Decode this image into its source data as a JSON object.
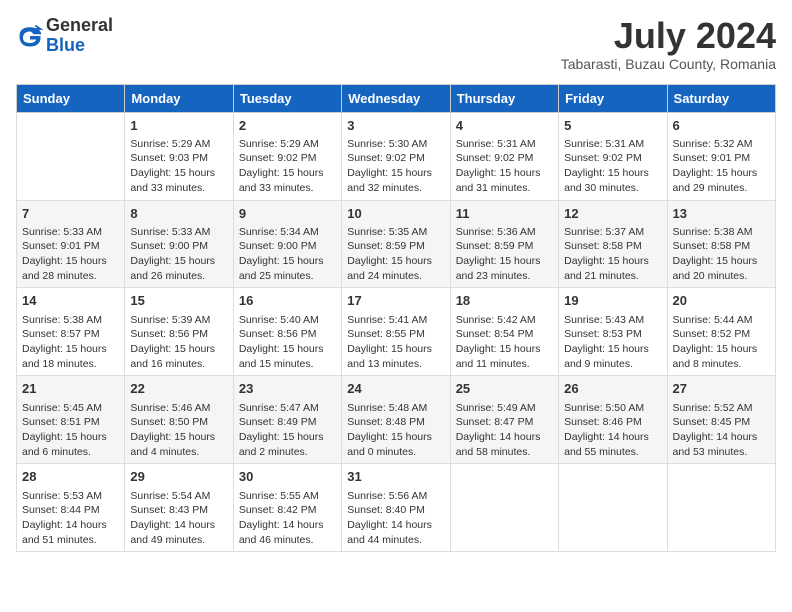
{
  "header": {
    "logo_general": "General",
    "logo_blue": "Blue",
    "month_title": "July 2024",
    "subtitle": "Tabarasti, Buzau County, Romania"
  },
  "days_of_week": [
    "Sunday",
    "Monday",
    "Tuesday",
    "Wednesday",
    "Thursday",
    "Friday",
    "Saturday"
  ],
  "weeks": [
    [
      {
        "day": "",
        "info": ""
      },
      {
        "day": "1",
        "info": "Sunrise: 5:29 AM\nSunset: 9:03 PM\nDaylight: 15 hours\nand 33 minutes."
      },
      {
        "day": "2",
        "info": "Sunrise: 5:29 AM\nSunset: 9:02 PM\nDaylight: 15 hours\nand 33 minutes."
      },
      {
        "day": "3",
        "info": "Sunrise: 5:30 AM\nSunset: 9:02 PM\nDaylight: 15 hours\nand 32 minutes."
      },
      {
        "day": "4",
        "info": "Sunrise: 5:31 AM\nSunset: 9:02 PM\nDaylight: 15 hours\nand 31 minutes."
      },
      {
        "day": "5",
        "info": "Sunrise: 5:31 AM\nSunset: 9:02 PM\nDaylight: 15 hours\nand 30 minutes."
      },
      {
        "day": "6",
        "info": "Sunrise: 5:32 AM\nSunset: 9:01 PM\nDaylight: 15 hours\nand 29 minutes."
      }
    ],
    [
      {
        "day": "7",
        "info": "Sunrise: 5:33 AM\nSunset: 9:01 PM\nDaylight: 15 hours\nand 28 minutes."
      },
      {
        "day": "8",
        "info": "Sunrise: 5:33 AM\nSunset: 9:00 PM\nDaylight: 15 hours\nand 26 minutes."
      },
      {
        "day": "9",
        "info": "Sunrise: 5:34 AM\nSunset: 9:00 PM\nDaylight: 15 hours\nand 25 minutes."
      },
      {
        "day": "10",
        "info": "Sunrise: 5:35 AM\nSunset: 8:59 PM\nDaylight: 15 hours\nand 24 minutes."
      },
      {
        "day": "11",
        "info": "Sunrise: 5:36 AM\nSunset: 8:59 PM\nDaylight: 15 hours\nand 23 minutes."
      },
      {
        "day": "12",
        "info": "Sunrise: 5:37 AM\nSunset: 8:58 PM\nDaylight: 15 hours\nand 21 minutes."
      },
      {
        "day": "13",
        "info": "Sunrise: 5:38 AM\nSunset: 8:58 PM\nDaylight: 15 hours\nand 20 minutes."
      }
    ],
    [
      {
        "day": "14",
        "info": "Sunrise: 5:38 AM\nSunset: 8:57 PM\nDaylight: 15 hours\nand 18 minutes."
      },
      {
        "day": "15",
        "info": "Sunrise: 5:39 AM\nSunset: 8:56 PM\nDaylight: 15 hours\nand 16 minutes."
      },
      {
        "day": "16",
        "info": "Sunrise: 5:40 AM\nSunset: 8:56 PM\nDaylight: 15 hours\nand 15 minutes."
      },
      {
        "day": "17",
        "info": "Sunrise: 5:41 AM\nSunset: 8:55 PM\nDaylight: 15 hours\nand 13 minutes."
      },
      {
        "day": "18",
        "info": "Sunrise: 5:42 AM\nSunset: 8:54 PM\nDaylight: 15 hours\nand 11 minutes."
      },
      {
        "day": "19",
        "info": "Sunrise: 5:43 AM\nSunset: 8:53 PM\nDaylight: 15 hours\nand 9 minutes."
      },
      {
        "day": "20",
        "info": "Sunrise: 5:44 AM\nSunset: 8:52 PM\nDaylight: 15 hours\nand 8 minutes."
      }
    ],
    [
      {
        "day": "21",
        "info": "Sunrise: 5:45 AM\nSunset: 8:51 PM\nDaylight: 15 hours\nand 6 minutes."
      },
      {
        "day": "22",
        "info": "Sunrise: 5:46 AM\nSunset: 8:50 PM\nDaylight: 15 hours\nand 4 minutes."
      },
      {
        "day": "23",
        "info": "Sunrise: 5:47 AM\nSunset: 8:49 PM\nDaylight: 15 hours\nand 2 minutes."
      },
      {
        "day": "24",
        "info": "Sunrise: 5:48 AM\nSunset: 8:48 PM\nDaylight: 15 hours\nand 0 minutes."
      },
      {
        "day": "25",
        "info": "Sunrise: 5:49 AM\nSunset: 8:47 PM\nDaylight: 14 hours\nand 58 minutes."
      },
      {
        "day": "26",
        "info": "Sunrise: 5:50 AM\nSunset: 8:46 PM\nDaylight: 14 hours\nand 55 minutes."
      },
      {
        "day": "27",
        "info": "Sunrise: 5:52 AM\nSunset: 8:45 PM\nDaylight: 14 hours\nand 53 minutes."
      }
    ],
    [
      {
        "day": "28",
        "info": "Sunrise: 5:53 AM\nSunset: 8:44 PM\nDaylight: 14 hours\nand 51 minutes."
      },
      {
        "day": "29",
        "info": "Sunrise: 5:54 AM\nSunset: 8:43 PM\nDaylight: 14 hours\nand 49 minutes."
      },
      {
        "day": "30",
        "info": "Sunrise: 5:55 AM\nSunset: 8:42 PM\nDaylight: 14 hours\nand 46 minutes."
      },
      {
        "day": "31",
        "info": "Sunrise: 5:56 AM\nSunset: 8:40 PM\nDaylight: 14 hours\nand 44 minutes."
      },
      {
        "day": "",
        "info": ""
      },
      {
        "day": "",
        "info": ""
      },
      {
        "day": "",
        "info": ""
      }
    ]
  ]
}
